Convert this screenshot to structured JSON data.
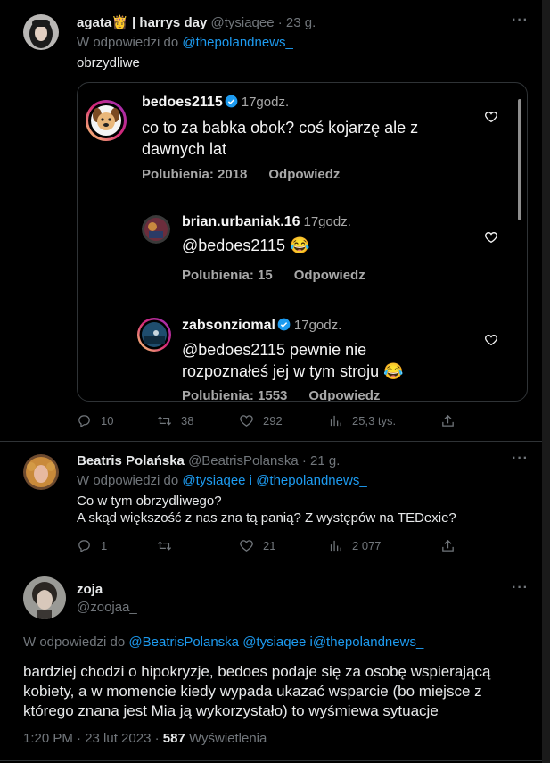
{
  "tweet1": {
    "name": "agata",
    "name_emoji": "👸",
    "name_suffix": "| harrys day",
    "handle": "@tysiaqee",
    "time": "· 23 g.",
    "reply_prefix": "W odpowiedzi do",
    "reply_to": "@thepolandnews_",
    "text": "obrzydliwe",
    "actions": {
      "replies": "10",
      "retweets": "38",
      "likes": "292",
      "views": "25,3 tys."
    }
  },
  "embed": {
    "comments": [
      {
        "user": "bedoes2115",
        "time": "17godz.",
        "text": "co to za babka obok? coś kojarzę ale z dawnych lat",
        "likes": "Polubienia: 2018",
        "reply": "Odpowiedz"
      },
      {
        "user": "brian.urbaniak.16",
        "time": "17godz.",
        "text": "@bedoes2115 😂",
        "likes": "Polubienia: 15",
        "reply": "Odpowiedz"
      },
      {
        "user": "zabsonziomal",
        "time": "17godz.",
        "text": "@bedoes2115 pewnie nie rozpoznałeś jej w tym stroju 😂",
        "likes": "Polubienia: 1553",
        "reply": "Odpowiedz"
      }
    ]
  },
  "tweet2": {
    "name": "Beatris Polańska",
    "handle": "@BeatrisPolanska",
    "time": "· 21 g.",
    "reply_prefix": "W odpowiedzi do",
    "reply_to_1": "@tysiaqee",
    "reply_joiner": " i ",
    "reply_to_2": "@thepolandnews_",
    "line1": "Co w tym obrzydliwego?",
    "line2": "A skąd większość z nas zna tą panią? Z występów na TEDexie?",
    "actions": {
      "replies": "1",
      "retweets": "",
      "likes": "21",
      "views": "2 077"
    }
  },
  "main": {
    "name": "zoja",
    "handle": "@zoojaa_",
    "reply_prefix": "W odpowiedzi do",
    "reply_to_1": "@BeatrisPolanska",
    "reply_to_2": "@tysiaqee",
    "reply_joiner": " i",
    "reply_to_3": "@thepolandnews_",
    "text": "bardziej chodzi o hipokryzje, bedoes podaje się za osobę wspierającą kobiety, a w momencie kiedy wypada ukazać wsparcie (bo miejsce z którego znana jest Mia ją wykorzystało) to wyśmiewa sytuacje",
    "time": "1:20 PM · 23 lut 2023 ·",
    "views_count": "587",
    "views_label": "Wyświetlenia"
  },
  "icons": {
    "more": "more-icon",
    "reply": "reply-icon",
    "retweet": "retweet-icon",
    "like": "heart-icon",
    "views": "views-icon",
    "share": "share-icon"
  },
  "colors": {
    "link": "#1d9bf0",
    "muted": "#71767b",
    "background": "#000000",
    "verified": "#1d9bf0"
  }
}
